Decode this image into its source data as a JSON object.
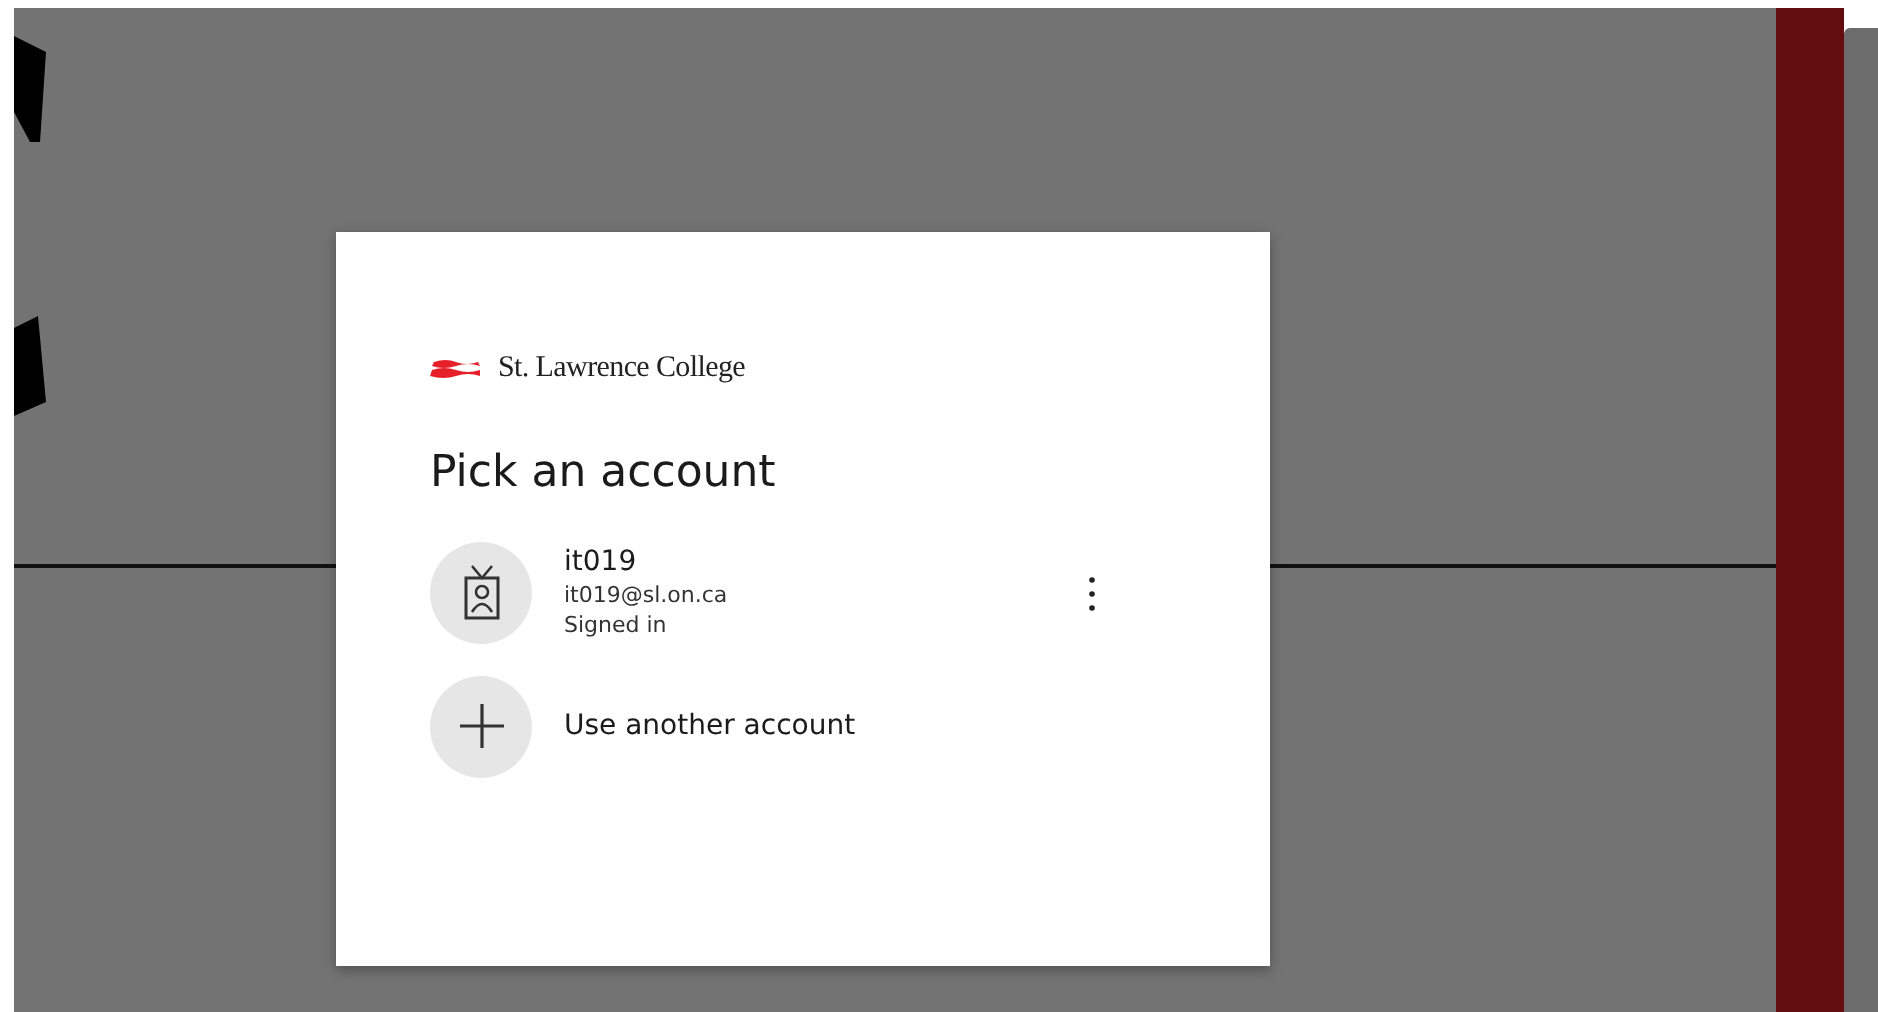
{
  "dialog": {
    "brand": "St. Lawrence College",
    "title": "Pick an account",
    "accounts": [
      {
        "name": "it019",
        "email": "it019@sl.on.ca",
        "status": "Signed in"
      }
    ],
    "other_option": "Use another account"
  }
}
